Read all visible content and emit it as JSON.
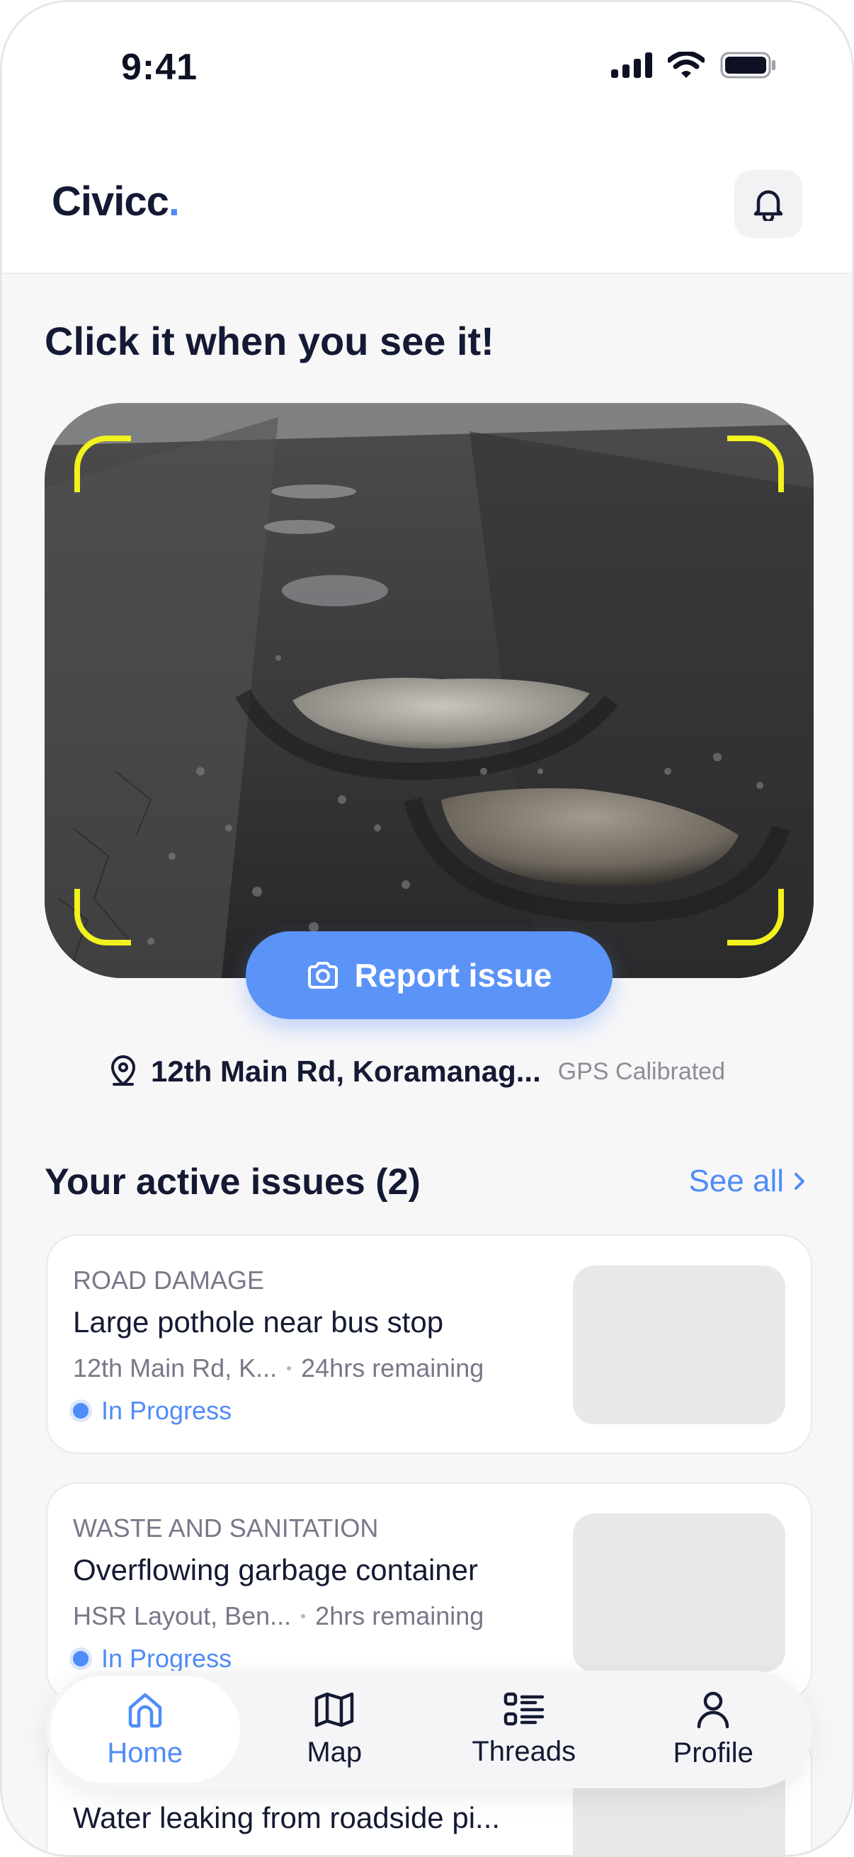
{
  "status_bar": {
    "time": "9:41"
  },
  "header": {
    "logo_text": "Civicc",
    "logo_dot": "."
  },
  "hero": {
    "title": "Click it when you see it!"
  },
  "camera": {
    "action_label": "Report issue"
  },
  "location": {
    "address": "12th Main Rd, Koramanag...",
    "gps_status": "GPS Calibrated"
  },
  "issues_section": {
    "title": "Your active issues (2)",
    "see_all_label": "See all"
  },
  "issues": [
    {
      "category": "ROAD DAMAGE",
      "title": "Large pothole near bus stop",
      "address": "12th Main Rd, K...",
      "time_remaining": "24hrs remaining",
      "status": "In Progress"
    },
    {
      "category": "WASTE AND SANITATION",
      "title": "Overflowing garbage container",
      "address": "HSR Layout, Ben...",
      "time_remaining": "2hrs remaining",
      "status": "In Progress"
    },
    {
      "category": "",
      "title": "Water leaking from roadside pi...",
      "address": "",
      "time_remaining": "",
      "status": ""
    }
  ],
  "nav": {
    "items": [
      {
        "label": "Home",
        "icon": "home-icon",
        "active": true
      },
      {
        "label": "Map",
        "icon": "map-icon",
        "active": false
      },
      {
        "label": "Threads",
        "icon": "threads-icon",
        "active": false
      },
      {
        "label": "Profile",
        "icon": "profile-icon",
        "active": false
      }
    ]
  },
  "colors": {
    "accent": "#4f8cf7",
    "viewfinder": "#f2f21c",
    "text_primary": "#141a33",
    "text_secondary": "#77798a"
  }
}
